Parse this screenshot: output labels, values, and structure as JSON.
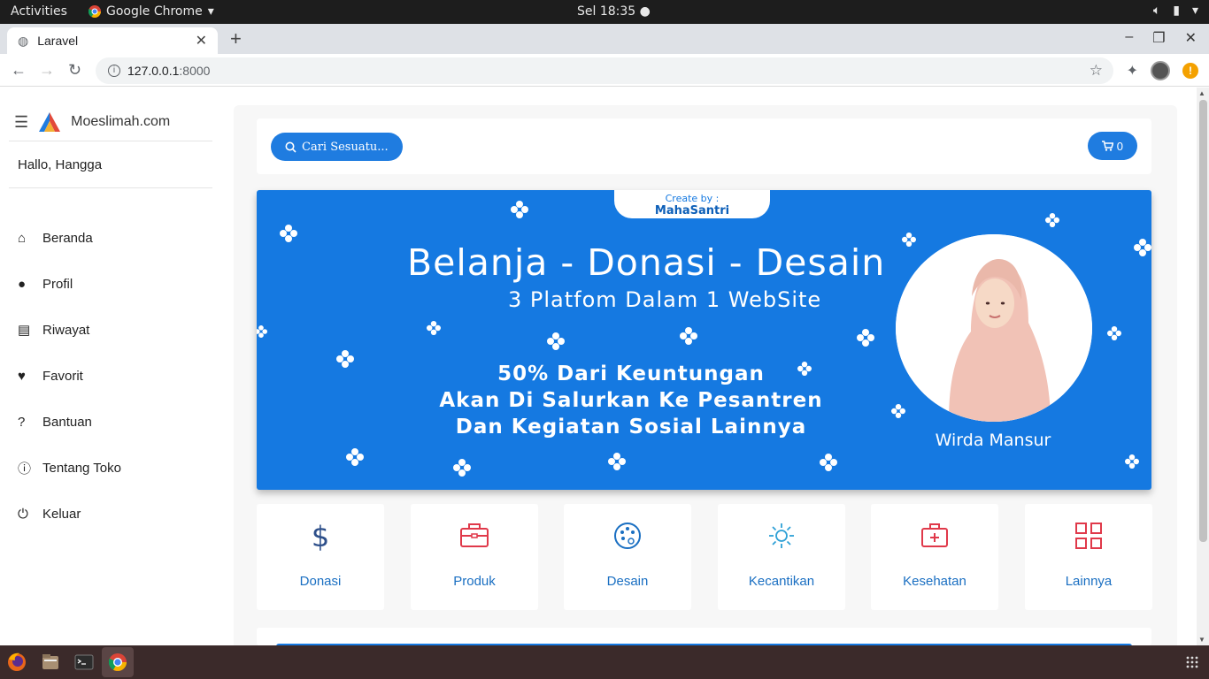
{
  "topbar": {
    "activities": "Activities",
    "app_name": "Google Chrome",
    "clock": "Sel 18:35"
  },
  "browser": {
    "tab_title": "Laravel",
    "url_host": "127.0.0.1",
    "url_port": ":8000"
  },
  "sidebar": {
    "brand": "Moeslimah.com",
    "greeting": "Hallo, Hangga",
    "items": [
      {
        "label": "Beranda",
        "icon": "home-icon"
      },
      {
        "label": "Profil",
        "icon": "person-icon"
      },
      {
        "label": "Riwayat",
        "icon": "clipboard-icon"
      },
      {
        "label": "Favorit",
        "icon": "heart-icon"
      },
      {
        "label": "Bantuan",
        "icon": "question-icon"
      },
      {
        "label": "Tentang Toko",
        "icon": "info-icon"
      },
      {
        "label": "Keluar",
        "icon": "power-icon"
      }
    ]
  },
  "search": {
    "label": "Cari  Sesuatu..."
  },
  "cart": {
    "count": "0"
  },
  "banner": {
    "created_by": "Create by :",
    "creator": "MahaSantri",
    "headline": "Belanja - Donasi - Desain",
    "subheadline": "3 Platfom Dalam 1 WebSite",
    "line1": "50% Dari Keuntungan",
    "line2": "Akan Di Salurkan Ke Pesantren",
    "line3": "Dan Kegiatan Sosial Lainnya",
    "person_name": "Wirda Mansur",
    "bg_color": "#1579e1"
  },
  "categories": [
    {
      "label": "Donasi",
      "icon": "dollar-icon",
      "color": "#2d4f8a"
    },
    {
      "label": "Produk",
      "icon": "briefcase-icon",
      "color": "#e0394a"
    },
    {
      "label": "Desain",
      "icon": "palette-icon",
      "color": "#1a6fc2"
    },
    {
      "label": "Kecantikan",
      "icon": "sun-icon",
      "color": "#2ea0d6"
    },
    {
      "label": "Kesehatan",
      "icon": "medkit-icon",
      "color": "#e0394a"
    },
    {
      "label": "Lainnya",
      "icon": "grid-icon",
      "color": "#e0394a"
    }
  ]
}
